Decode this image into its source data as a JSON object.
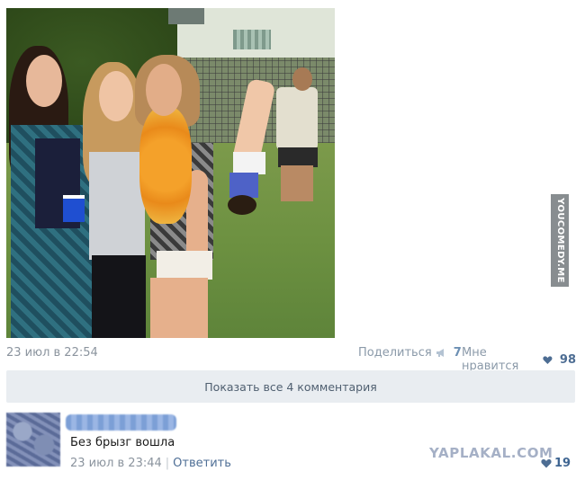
{
  "watermark_side": "YOUCOMEDY.ME",
  "post": {
    "date": "23 июл в 22:54",
    "share_label": "Поделиться",
    "share_count": "7",
    "like_label": "Мне нравится",
    "like_count": "98"
  },
  "comments_bar": {
    "label": "Показать все 4 комментария"
  },
  "comment": {
    "text": "Без брызг вошла",
    "date": "23 июл в 23:44",
    "separator": "|",
    "reply_label": "Ответить",
    "like_count": "19"
  },
  "brand_watermark": "YAPLAKAL.COM",
  "colors": {
    "link": "#4f6f96",
    "muted": "#8b949e",
    "bar_bg": "#e9edf1",
    "heart": "#4d6d93"
  },
  "icons": {
    "share": "megaphone-icon",
    "like": "heart-icon"
  }
}
